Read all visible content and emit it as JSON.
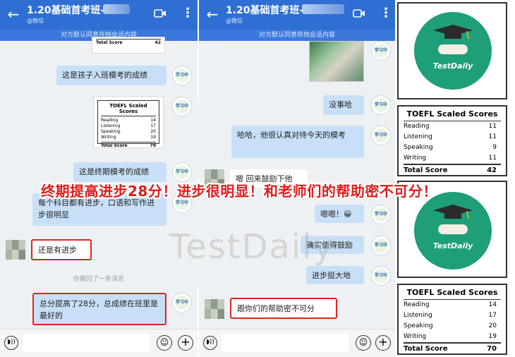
{
  "chat_left": {
    "title": "1.20基础首考班-",
    "subtitle": "@微信",
    "notice": "对方默认同意存档会话内容",
    "card_total_label": "Total Score",
    "card_total_value": "42",
    "messages": [
      "这是孩子入班模考的成绩",
      "这是终期模考的成绩",
      "每个科目都有进步，口语和写作进步很明显",
      "还是有进步",
      "总分提高了28分，总成绩在班里是最好的"
    ],
    "recall_notice": "你撤回了一条消息",
    "mini_card": {
      "title": "TOEFL Scaled Scores",
      "rows": [
        {
          "label": "Reading",
          "value": "14"
        },
        {
          "label": "Listening",
          "value": "17"
        },
        {
          "label": "Speaking",
          "value": "20"
        },
        {
          "label": "Writing",
          "value": "19"
        }
      ],
      "total_label": "Total Score",
      "total_value": "70"
    },
    "avatar_text": "学习中"
  },
  "chat_right": {
    "title": "1.20基础首考班-",
    "subtitle": "@微信",
    "notice": "对方默认同意存档会话内容",
    "messages": [
      "没事哈",
      "哈哈，他很认真对待今天的模考",
      "嗯 回来鼓励下他",
      "嗯嗯！😀",
      "确实值得鼓励",
      "进步挺大地",
      "跟你们的帮助密不可分"
    ],
    "avatar_text": "学习中"
  },
  "right_panel": {
    "logo_text": "TestDaily",
    "score_box_1": {
      "title": "TOEFL Scaled Scores",
      "rows": [
        {
          "label": "Reading",
          "value": "11"
        },
        {
          "label": "Listening",
          "value": "11"
        },
        {
          "label": "Speaking",
          "value": "9"
        },
        {
          "label": "Writing",
          "value": "11"
        }
      ],
      "total_label": "Total Score",
      "total_value": "42"
    },
    "score_box_2": {
      "title": "TOEFL Scaled Scores",
      "rows": [
        {
          "label": "Reading",
          "value": "14"
        },
        {
          "label": "Listening",
          "value": "17"
        },
        {
          "label": "Speaking",
          "value": "20"
        },
        {
          "label": "Writing",
          "value": "19"
        }
      ],
      "total_label": "Total Score",
      "total_value": "70"
    }
  },
  "banner": "终期提高进步28分！进步很明显！和老师们的帮助密不可分！",
  "watermark": "TestDaily",
  "colors": {
    "topbar": "#2f6fd3",
    "bubble_right": "#c8e0f7",
    "highlight_red": "#e0231b",
    "logo_green": "#1f9e7a"
  }
}
